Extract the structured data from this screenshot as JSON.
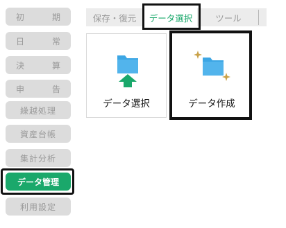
{
  "sidebar": {
    "items": [
      {
        "label": "初　期"
      },
      {
        "label": "日　常"
      },
      {
        "label": "決　算"
      },
      {
        "label": "申　告"
      },
      {
        "label": "繰越処理"
      },
      {
        "label": "資産台帳"
      },
      {
        "label": "集計分析"
      },
      {
        "label": "データ管理",
        "active": true
      },
      {
        "label": "利用設定"
      }
    ]
  },
  "tabs": [
    {
      "label": "保存・復元"
    },
    {
      "label": "データ選択",
      "active": true
    },
    {
      "label": "ツール"
    }
  ],
  "cards": [
    {
      "label": "データ選択",
      "icon": "folder-upload-icon"
    },
    {
      "label": "データ作成",
      "icon": "folder-new-icon"
    }
  ],
  "colors": {
    "accent": "#1aa86b",
    "folder_blue": "#3ca6e4",
    "sparkle_gold": "#c9a24a",
    "inactive_bg": "#dcdcdc",
    "inactive_text": "#9a9a9a"
  }
}
